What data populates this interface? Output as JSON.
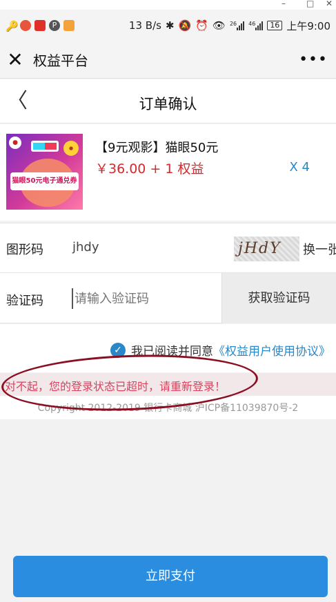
{
  "window_controls": {
    "minimize": "–",
    "maximize": "□",
    "close": "✕"
  },
  "statusbar": {
    "speed": "13 B/s",
    "signal_1": "26",
    "signal_2": "46",
    "battery": "16",
    "time": "上午9:00",
    "icons": [
      "key-icon",
      "app-icon",
      "app-icon",
      "parking-icon",
      "app-icon",
      "bluetooth-icon",
      "mute-icon",
      "alarm-icon",
      "eye-icon",
      "signal-icon",
      "signal-icon",
      "battery-icon"
    ]
  },
  "wx": {
    "close_symbol": "✕",
    "title": "权益平台",
    "more_symbol": "•••"
  },
  "nav": {
    "back_symbol": "〈",
    "title": "订单确认"
  },
  "product": {
    "name": "【9元观影】猫眼50元",
    "price": "￥36.00 + 1 权益",
    "quantity": "X 4",
    "image_ticket_text": "猫眼50元电子通兑券",
    "image_badge_text": "猫眼"
  },
  "captcha": {
    "label": "图形码",
    "value": "jhdy",
    "image_text": "jHdY",
    "refresh_label": "换一张"
  },
  "sms": {
    "label": "验证码",
    "placeholder": "请输入验证码",
    "button_label": "获取验证码"
  },
  "agreement": {
    "text": "我已阅读并同意",
    "link": "《权益用户使用协议》"
  },
  "error": {
    "message": "对不起，您的登录状态已超时，请重新登录！"
  },
  "copyright": "Copyright 2012-2019 银行卡商城 沪ICP备11039870号-2",
  "pay_button": {
    "label": "立即支付"
  },
  "colors": {
    "accent": "#2a87c8",
    "price": "#d8262a",
    "error": "#d9425e",
    "pay_button": "#2a8de0"
  }
}
